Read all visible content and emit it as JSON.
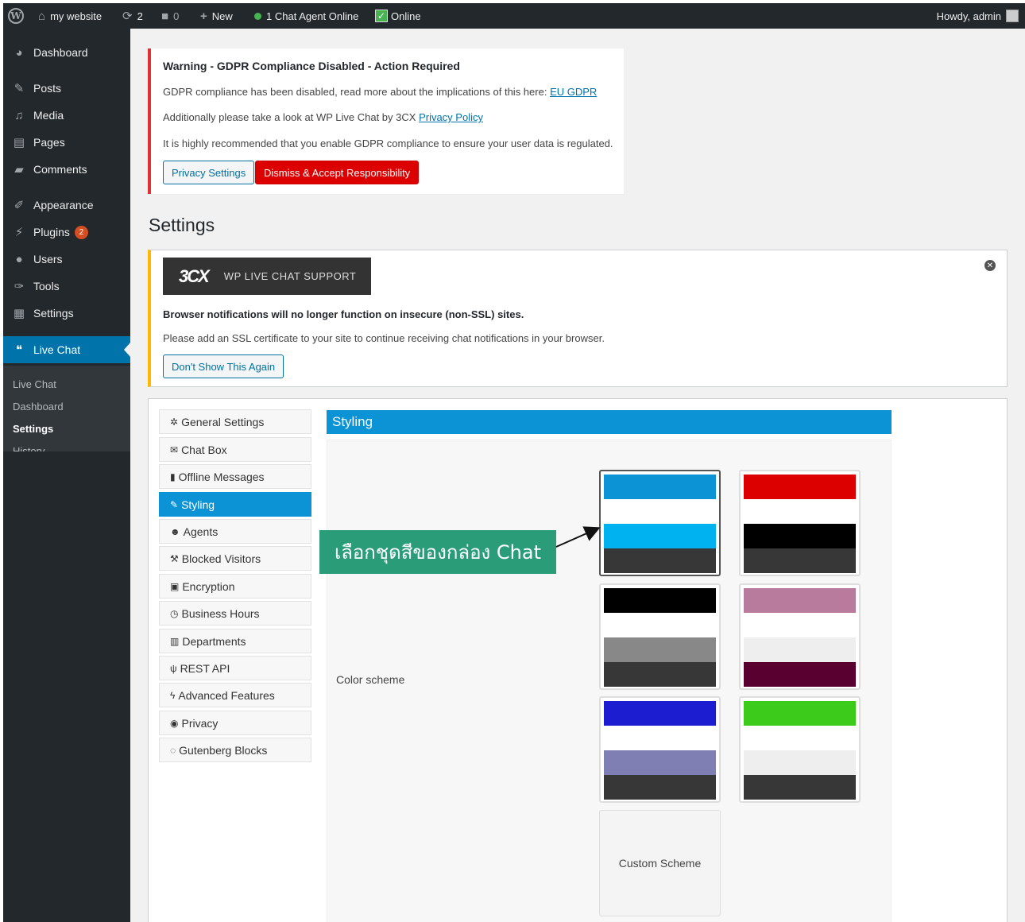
{
  "adminbar": {
    "site_name": "my website",
    "updates_count": "2",
    "comments_count": "0",
    "new_label": "New",
    "agent_status": "1 Chat Agent Online",
    "online_label": "Online",
    "howdy": "Howdy, admin"
  },
  "sidebar": {
    "items": [
      {
        "label": "Dashboard",
        "icon": "dashboard-icon"
      },
      {
        "label": "Posts",
        "icon": "pin-icon"
      },
      {
        "label": "Media",
        "icon": "media-icon"
      },
      {
        "label": "Pages",
        "icon": "pages-icon"
      },
      {
        "label": "Comments",
        "icon": "comment-icon"
      },
      {
        "label": "Appearance",
        "icon": "brush-icon"
      },
      {
        "label": "Plugins",
        "icon": "plugin-icon",
        "badge": "2"
      },
      {
        "label": "Users",
        "icon": "user-icon"
      },
      {
        "label": "Tools",
        "icon": "wrench-icon"
      },
      {
        "label": "Settings",
        "icon": "settings-icon"
      },
      {
        "label": "Live Chat",
        "icon": "chat-icon"
      }
    ],
    "submenu": [
      "Live Chat",
      "Dashboard",
      "Settings",
      "History"
    ]
  },
  "gdpr_notice": {
    "title": "Warning - GDPR Compliance Disabled - Action Required",
    "line1": "GDPR compliance has been disabled, read more about the implications of this here:",
    "line1_link": "EU GDPR",
    "line2": "Additionally please take a look at WP Live Chat by 3CX",
    "line2_link": "Privacy Policy",
    "line3": "It is highly recommended that you enable GDPR compliance to ensure your user data is regulated.",
    "privacy_button": "Privacy Settings",
    "dismiss_button": "Dismiss & Accept Responsibility"
  },
  "page_title": "Settings",
  "ssl_notice": {
    "logo_brand": "3CX",
    "logo_tagline": "WP LIVE CHAT SUPPORT",
    "bold_line": "Browser notifications will no longer function on insecure (non-SSL) sites.",
    "plain_line": "Please add an SSL certificate to your site to continue receiving chat notifications in your browser.",
    "button": "Don't Show This Again"
  },
  "tabs": [
    {
      "label": "General Settings",
      "icon": "gear-icon"
    },
    {
      "label": "Chat Box",
      "icon": "envelope-icon"
    },
    {
      "label": "Offline Messages",
      "icon": "book-icon"
    },
    {
      "label": "Styling",
      "icon": "pencil-icon",
      "active": true
    },
    {
      "label": "Agents",
      "icon": "users-icon"
    },
    {
      "label": "Blocked Visitors",
      "icon": "gavel-icon"
    },
    {
      "label": "Encryption",
      "icon": "lock-icon"
    },
    {
      "label": "Business Hours",
      "icon": "clock-icon"
    },
    {
      "label": "Departments",
      "icon": "bank-icon"
    },
    {
      "label": "REST API",
      "icon": "plug-icon"
    },
    {
      "label": "Advanced Features",
      "icon": "bolt-icon"
    },
    {
      "label": "Privacy",
      "icon": "eye-icon"
    },
    {
      "label": "Gutenberg Blocks",
      "icon": "speech-icon"
    }
  ],
  "styling": {
    "header": "Styling",
    "color_scheme_label": "Color scheme",
    "custom_scheme_label": "Custom Scheme",
    "schemes": [
      {
        "colors": [
          "#0b93d5",
          "#ffffff",
          "#00b2f0",
          "#373737"
        ],
        "selected": true
      },
      {
        "colors": [
          "#dd0000",
          "#ffffff",
          "#000000",
          "#373737"
        ]
      },
      {
        "colors": [
          "#000000",
          "#ffffff",
          "#888888",
          "#373737"
        ]
      },
      {
        "colors": [
          "#b97b9d",
          "#ffffff",
          "#eeeeee",
          "#5a0031"
        ]
      },
      {
        "colors": [
          "#1c1cd0",
          "#ffffff",
          "#7f7fb4",
          "#373737"
        ]
      },
      {
        "colors": [
          "#3cca1b",
          "#ffffff",
          "#eeeeee",
          "#373737"
        ]
      }
    ]
  },
  "callout": {
    "text": "เลือกชุดสีของกล่อง Chat"
  },
  "colors": {
    "admin_dark": "#23282d",
    "wp_blue": "#0073aa",
    "plugin_blue": "#0b93d5",
    "error_red": "#dc3232",
    "warn_yellow": "#ffb900",
    "callout_green": "#2a9d78"
  }
}
